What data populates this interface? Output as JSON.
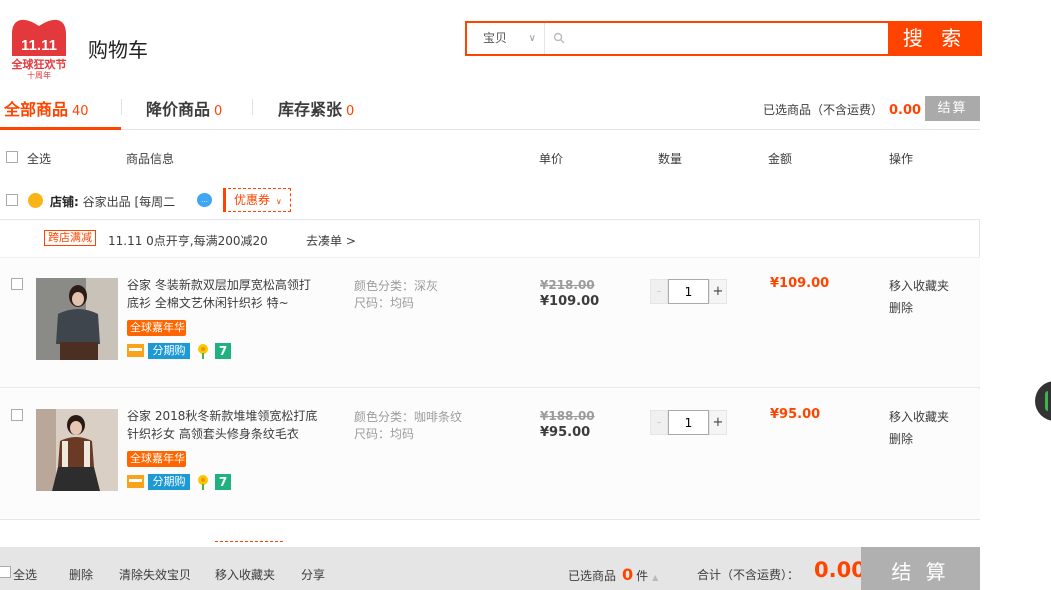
{
  "header": {
    "logo": {
      "main": "11.11",
      "sub": "全球狂欢节",
      "anniv": "十周年",
      "color": "#e4393c"
    },
    "title": "购物车",
    "search": {
      "category": "宝贝",
      "placeholder": "",
      "button": "搜 索"
    }
  },
  "tabs": [
    {
      "label": "全部商品",
      "count": "40"
    },
    {
      "label": "降价商品",
      "count": "0"
    },
    {
      "label": "库存紧张",
      "count": "0"
    }
  ],
  "summary": {
    "label": "已选商品（不含运费）",
    "amount": "0.00",
    "checkout": "结算"
  },
  "columns": {
    "select_all": "全选",
    "info": "商品信息",
    "unit_price": "单价",
    "quantity": "数量",
    "amount": "金额",
    "actions": "操作"
  },
  "shop": {
    "label": "店铺:",
    "name": "谷家出品 [每周二",
    "coupon": "优惠券",
    "promo_tag": "跨店满减",
    "promo_text": "11.11 0点开亨,每满200减20",
    "promo_link": "去凑单 >"
  },
  "items": [
    {
      "title": "谷家 冬装新款双层加厚宽松高领打底衫 全棉文艺休闲针织衫 特~",
      "badge": "全球嘉年华",
      "installment": "分期购",
      "seven": "7",
      "attr_color": "颜色分类：深灰",
      "attr_size": "尺码：均码",
      "price_orig": "¥218.00",
      "price_now": "¥109.00",
      "qty": "1",
      "amount": "¥109.00",
      "op_fav": "移入收藏夹",
      "op_del": "删除"
    },
    {
      "title": "谷家 2018秋冬新款堆堆领宽松打底针织衫女 高领套头修身条纹毛衣",
      "badge": "全球嘉年华",
      "installment": "分期购",
      "seven": "7",
      "attr_color": "颜色分类：咖啡条纹",
      "attr_size": "尺码：均码",
      "price_orig": "¥188.00",
      "price_now": "¥95.00",
      "qty": "1",
      "amount": "¥95.00",
      "op_fav": "移入收藏夹",
      "op_del": "删除"
    }
  ],
  "footer": {
    "select_all": "全选",
    "delete": "删除",
    "clear_invalid": "清除失效宝贝",
    "move_fav": "移入收藏夹",
    "share": "分享",
    "selected_label": "已选商品",
    "selected_count": "0",
    "unit": "件",
    "total_label": "合计（不含运费）：",
    "total_amount": "0.00",
    "checkout": "结 算"
  },
  "colors": {
    "accent": "#ff4400",
    "disabled": "#aaaaaa"
  }
}
